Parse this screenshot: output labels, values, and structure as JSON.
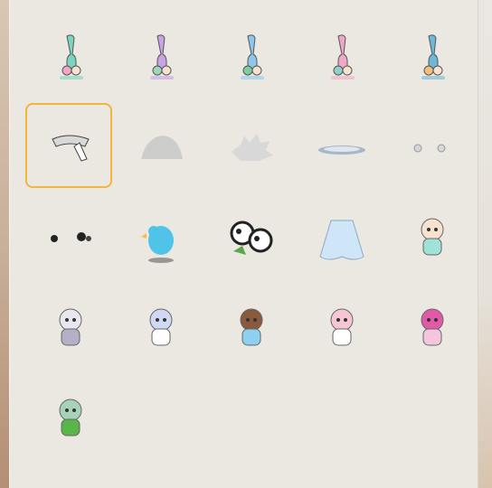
{
  "items": [
    {
      "name": "dino-stand-green-icon",
      "color": "#7bd4c0",
      "accent": "#f3a7c4"
    },
    {
      "name": "dino-stand-purple-icon",
      "color": "#c7a2e6",
      "accent": "#9fd6b6"
    },
    {
      "name": "dino-stand-blue-icon",
      "color": "#8fc6ee",
      "accent": "#7ccf9b"
    },
    {
      "name": "dino-stand-pink-icon",
      "color": "#f0a8c8",
      "accent": "#8fd3c8"
    },
    {
      "name": "dino-stand-teal-icon",
      "color": "#6fb7d8",
      "accent": "#f4c07c"
    },
    {
      "name": "scarf-icon",
      "color": "#d8d8d8",
      "accent": "#ffffff",
      "selected": true
    },
    {
      "name": "gray-mound-icon",
      "color": "#bfc0c2",
      "accent": "#e8e8e8"
    },
    {
      "name": "white-splash-icon",
      "color": "#d8d8d8",
      "accent": "#ffffff"
    },
    {
      "name": "puddle-icon",
      "color": "#a6b5c8",
      "accent": "#dfe6ee"
    },
    {
      "name": "white-dots-icon",
      "color": "#d6d6d6",
      "accent": "#ffffff"
    },
    {
      "name": "black-dots-icon",
      "color": "#222222",
      "accent": "#444444"
    },
    {
      "name": "blue-parrot-icon",
      "color": "#4fc3e8",
      "accent": "#f2c14b"
    },
    {
      "name": "panda-pair-icon",
      "color": "#222222",
      "accent": "#ffffff"
    },
    {
      "name": "crystal-cape-icon",
      "color": "#cfe6f8",
      "accent": "#ffffff"
    },
    {
      "name": "bunny-character-icon",
      "color": "#f6e2cf",
      "accent": "#9ee3d6"
    },
    {
      "name": "ponytail-girl-icon",
      "color": "#e8e6ef",
      "accent": "#b5b0c8"
    },
    {
      "name": "nurse-character-icon",
      "color": "#cfd9f3",
      "accent": "#ffffff"
    },
    {
      "name": "bear-girl-icon",
      "color": "#8a5a3c",
      "accent": "#8ed0f0"
    },
    {
      "name": "pink-bear-icon",
      "color": "#f6c6d2",
      "accent": "#ffffff"
    },
    {
      "name": "magenta-flower-icon",
      "color": "#e25aa7",
      "accent": "#f4c6dd"
    },
    {
      "name": "green-hair-boy-icon",
      "color": "#a6d3b8",
      "accent": "#58b548"
    }
  ]
}
